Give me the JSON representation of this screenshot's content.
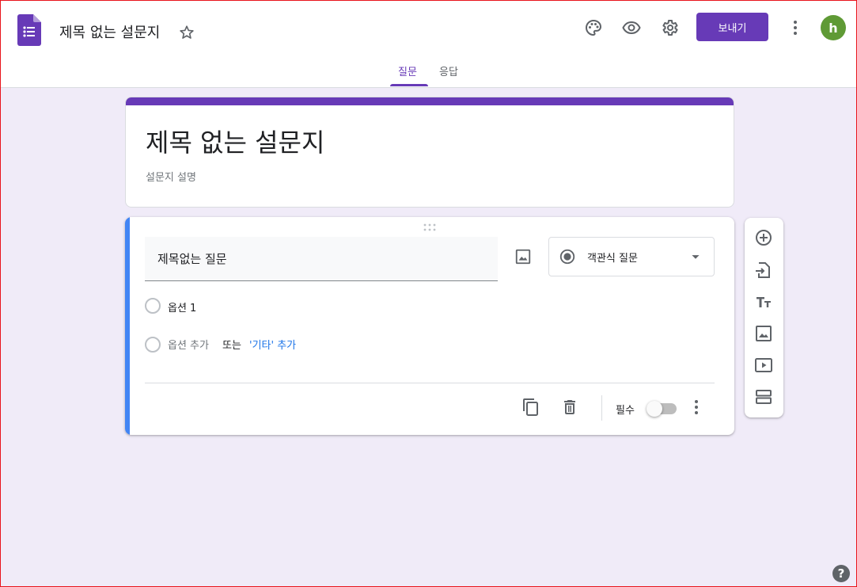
{
  "header": {
    "doc_title": "제목 없는 설문지",
    "send_label": "보내기",
    "avatar_initial": "h",
    "accent_color": "#673ab7",
    "avatar_color": "#5f9a35"
  },
  "tabs": [
    {
      "label": "질문",
      "active": true
    },
    {
      "label": "응답",
      "active": false
    }
  ],
  "form": {
    "title": "제목 없는 설문지",
    "description_placeholder": "설문지 설명"
  },
  "question": {
    "title": "제목없는 질문",
    "type_label": "객관식 질문",
    "options": [
      "옵션 1"
    ],
    "add_option_label": "옵션 추가",
    "or_label": "또는",
    "add_other_label": "'기타' 추가",
    "required_label": "필수",
    "required": false,
    "accent_color": "#4285f4"
  },
  "side_toolbar": {
    "icons": [
      "add-question-icon",
      "import-questions-icon",
      "add-title-icon",
      "add-image-icon",
      "add-video-icon",
      "add-section-icon"
    ]
  },
  "background_color": "#f0ebf8"
}
